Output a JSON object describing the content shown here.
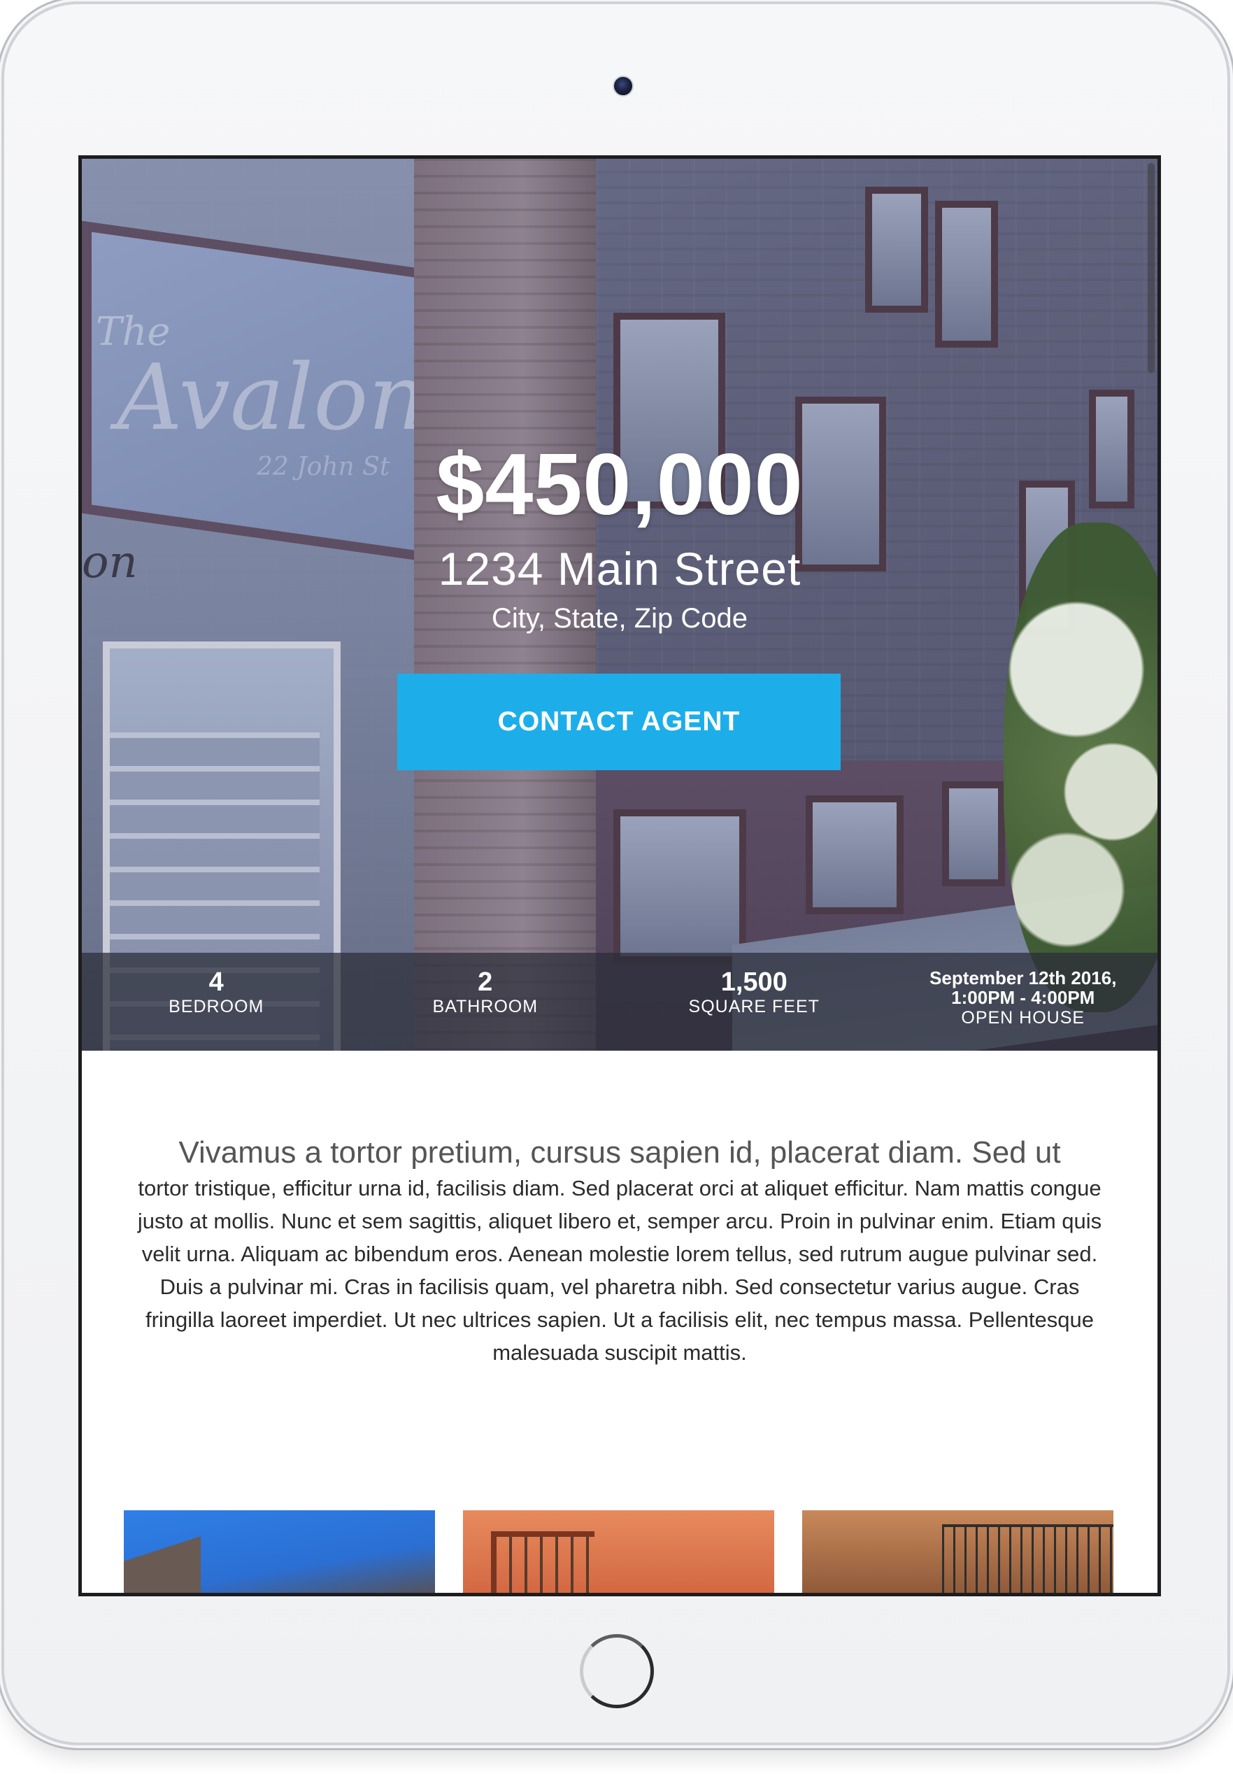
{
  "listing": {
    "price": "$450,000",
    "street": "1234 Main Street",
    "city_state_zip": "City, State, Zip Code",
    "contact_button": "CONTACT AGENT"
  },
  "hero_photo_sign": {
    "line1": "The",
    "line2": "Avalon",
    "line3": "22 John St",
    "door_text": "on"
  },
  "stats": [
    {
      "value": "4",
      "label": "BEDROOM"
    },
    {
      "value": "2",
      "label": "BATHROOM"
    },
    {
      "value": "1,500",
      "label": "SQUARE FEET"
    }
  ],
  "open_house": {
    "date_line1": "September 12th 2016,",
    "date_line2": "1:00PM - 4:00PM",
    "label": "OPEN HOUSE"
  },
  "description": {
    "lead": "Vivamus a tortor pretium, cursus sapien id, placerat diam. Sed ut",
    "body": "tortor tristique, efficitur urna id, facilisis diam. Sed placerat orci at aliquet efficitur. Nam mattis congue justo at mollis. Nunc et sem sagittis, aliquet libero et, semper arcu. Proin in pulvinar enim. Etiam quis velit urna. Aliquam ac bibendum eros. Aenean molestie lorem tellus, sed rutrum augue pulvinar sed. Duis a pulvinar mi. Cras in facilisis quam, vel pharetra nibh. Sed consectetur varius augue. Cras fringilla laoreet imperdiet. Ut nec ultrices sapien. Ut a facilisis elit, nec tempus massa. Pellentesque malesuada suscipit mattis."
  },
  "theme": {
    "accent": "#1daeea",
    "stats_bar": "#2a2c38",
    "text": "#333333"
  },
  "icons": [
    "camera-icon",
    "home-button-icon"
  ]
}
